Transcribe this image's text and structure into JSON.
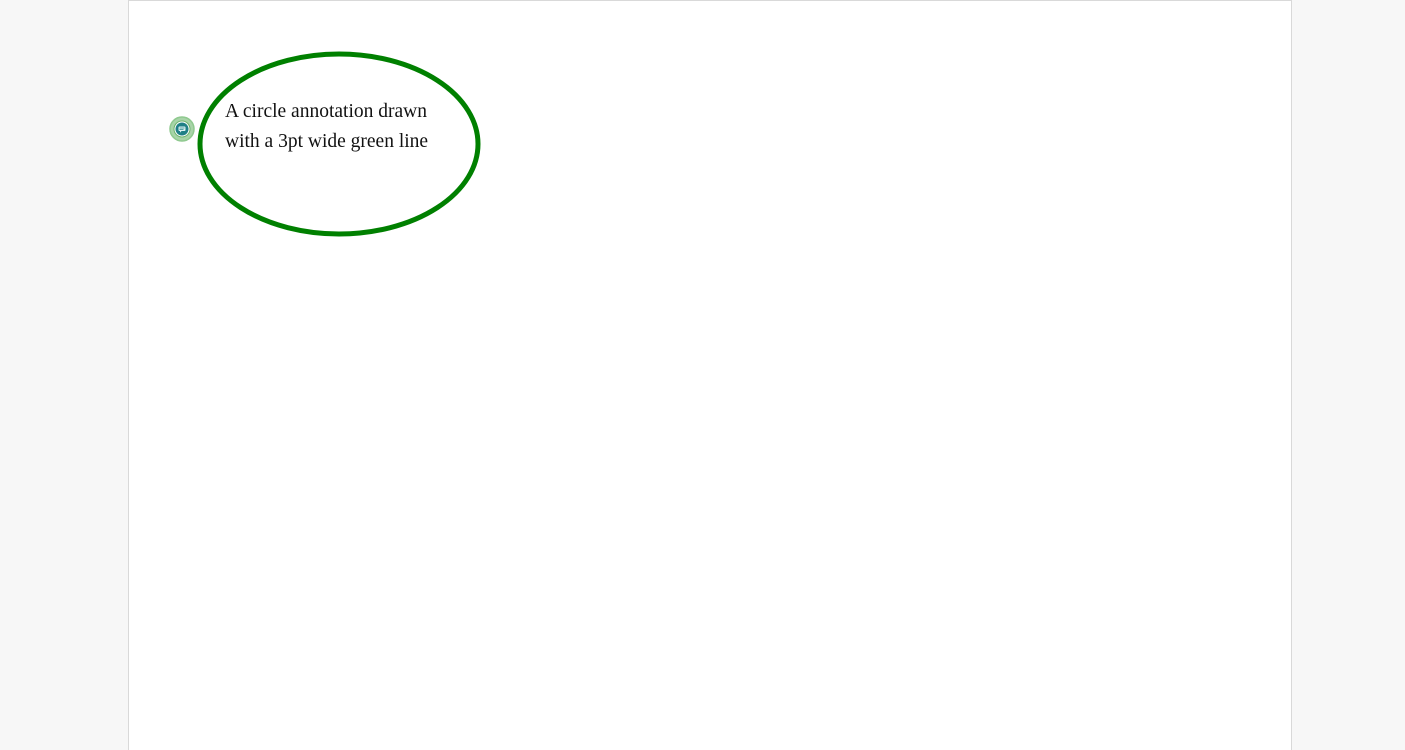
{
  "annotation": {
    "text_lines": [
      "A circle annotation drawn",
      "with a 3pt wide green line"
    ],
    "stroke_color": "#008000",
    "icon": "comment-bubble-icon"
  },
  "colors": {
    "viewer_background": "#f7f7f7",
    "page_background": "#ffffff",
    "marker_outer": "#8fc98f",
    "marker_inner": "#2a8a8a"
  }
}
